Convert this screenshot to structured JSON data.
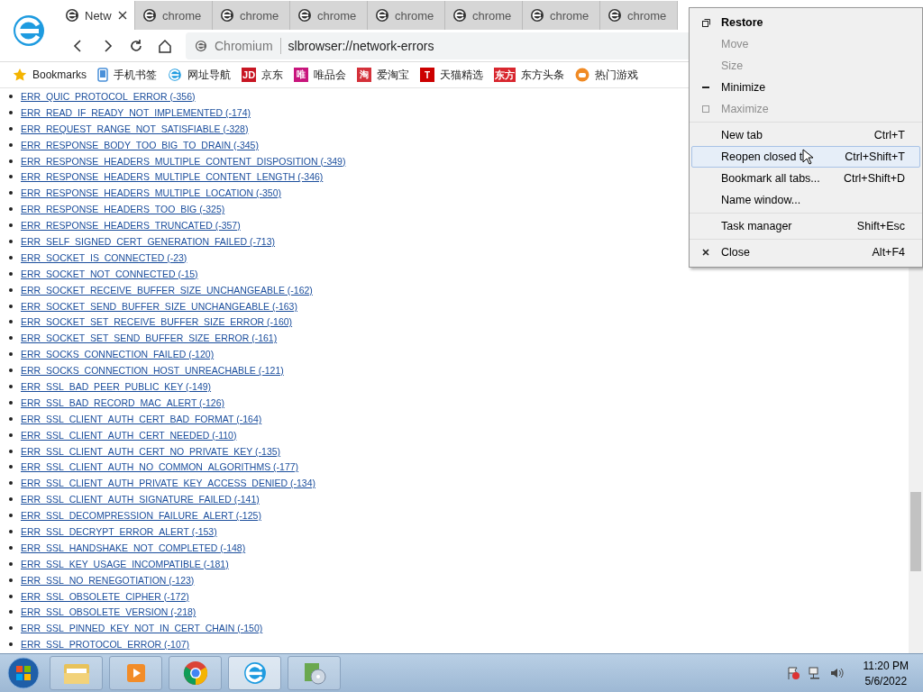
{
  "tabs": [
    {
      "title": "Netw",
      "selected": true,
      "closable": true
    },
    {
      "title": "chrome",
      "selected": false,
      "closable": false
    },
    {
      "title": "chrome",
      "selected": false,
      "closable": false
    },
    {
      "title": "chrome",
      "selected": false,
      "closable": false
    },
    {
      "title": "chrome",
      "selected": false,
      "closable": false
    },
    {
      "title": "chrome",
      "selected": false,
      "closable": false
    },
    {
      "title": "chrome",
      "selected": false,
      "closable": false
    },
    {
      "title": "chrome",
      "selected": false,
      "closable": false
    }
  ],
  "address_bar": {
    "site": "Chromium",
    "url": "slbrowser://network-errors"
  },
  "bookmarks": [
    {
      "label": "Bookmarks",
      "kind": "star"
    },
    {
      "label": "手机书签",
      "kind": "phone"
    },
    {
      "label": "网址导航",
      "kind": "browser"
    },
    {
      "label": "京东",
      "kind": "badge",
      "badge": "JD",
      "color": "#c81623"
    },
    {
      "label": "唯品会",
      "kind": "badge",
      "badge": "唯",
      "color": "#c8157c"
    },
    {
      "label": "爱淘宝",
      "kind": "badge",
      "badge": "淘",
      "color": "#d4313a"
    },
    {
      "label": "天猫精选",
      "kind": "badge",
      "badge": "T",
      "color": "#cc0000"
    },
    {
      "label": "东方头条",
      "kind": "badge",
      "badge": "东方",
      "color": "#d8262e"
    },
    {
      "label": "热门游戏",
      "kind": "game"
    }
  ],
  "error_links": [
    "ERR_QUIC_PROTOCOL_ERROR (-356)",
    "ERR_READ_IF_READY_NOT_IMPLEMENTED (-174)",
    "ERR_REQUEST_RANGE_NOT_SATISFIABLE (-328)",
    "ERR_RESPONSE_BODY_TOO_BIG_TO_DRAIN (-345)",
    "ERR_RESPONSE_HEADERS_MULTIPLE_CONTENT_DISPOSITION (-349)",
    "ERR_RESPONSE_HEADERS_MULTIPLE_CONTENT_LENGTH (-346)",
    "ERR_RESPONSE_HEADERS_MULTIPLE_LOCATION (-350)",
    "ERR_RESPONSE_HEADERS_TOO_BIG (-325)",
    "ERR_RESPONSE_HEADERS_TRUNCATED (-357)",
    "ERR_SELF_SIGNED_CERT_GENERATION_FAILED (-713)",
    "ERR_SOCKET_IS_CONNECTED (-23)",
    "ERR_SOCKET_NOT_CONNECTED (-15)",
    "ERR_SOCKET_RECEIVE_BUFFER_SIZE_UNCHANGEABLE (-162)",
    "ERR_SOCKET_SEND_BUFFER_SIZE_UNCHANGEABLE (-163)",
    "ERR_SOCKET_SET_RECEIVE_BUFFER_SIZE_ERROR (-160)",
    "ERR_SOCKET_SET_SEND_BUFFER_SIZE_ERROR (-161)",
    "ERR_SOCKS_CONNECTION_FAILED (-120)",
    "ERR_SOCKS_CONNECTION_HOST_UNREACHABLE (-121)",
    "ERR_SSL_BAD_PEER_PUBLIC_KEY (-149)",
    "ERR_SSL_BAD_RECORD_MAC_ALERT (-126)",
    "ERR_SSL_CLIENT_AUTH_CERT_BAD_FORMAT (-164)",
    "ERR_SSL_CLIENT_AUTH_CERT_NEEDED (-110)",
    "ERR_SSL_CLIENT_AUTH_CERT_NO_PRIVATE_KEY (-135)",
    "ERR_SSL_CLIENT_AUTH_NO_COMMON_ALGORITHMS (-177)",
    "ERR_SSL_CLIENT_AUTH_PRIVATE_KEY_ACCESS_DENIED (-134)",
    "ERR_SSL_CLIENT_AUTH_SIGNATURE_FAILED (-141)",
    "ERR_SSL_DECOMPRESSION_FAILURE_ALERT (-125)",
    "ERR_SSL_DECRYPT_ERROR_ALERT (-153)",
    "ERR_SSL_HANDSHAKE_NOT_COMPLETED (-148)",
    "ERR_SSL_KEY_USAGE_INCOMPATIBLE (-181)",
    "ERR_SSL_NO_RENEGOTIATION (-123)",
    "ERR_SSL_OBSOLETE_CIPHER (-172)",
    "ERR_SSL_OBSOLETE_VERSION (-218)",
    "ERR_SSL_PINNED_KEY_NOT_IN_CERT_CHAIN (-150)",
    "ERR_SSL_PROTOCOL_ERROR (-107)"
  ],
  "context_menu": {
    "groups": [
      [
        {
          "label": "Restore",
          "kind": "restore",
          "bold": true,
          "disabled": false,
          "selected": false
        },
        {
          "label": "Move",
          "kind": "plain",
          "bold": false,
          "disabled": true,
          "selected": false
        },
        {
          "label": "Size",
          "kind": "plain",
          "bold": false,
          "disabled": true,
          "selected": false
        },
        {
          "label": "Minimize",
          "kind": "minimize",
          "bold": false,
          "disabled": false,
          "selected": false
        },
        {
          "label": "Maximize",
          "kind": "maximize",
          "bold": false,
          "disabled": true,
          "selected": false
        }
      ],
      [
        {
          "label": "New tab",
          "shortcut": "Ctrl+T",
          "kind": "plain",
          "bold": false,
          "disabled": false,
          "selected": false
        },
        {
          "label": "Reopen closed t",
          "shortcut": "Ctrl+Shift+T",
          "kind": "plain",
          "bold": false,
          "disabled": false,
          "selected": true
        },
        {
          "label": "Bookmark all tabs...",
          "shortcut": "Ctrl+Shift+D",
          "kind": "plain",
          "bold": false,
          "disabled": false,
          "selected": false
        },
        {
          "label": "Name window...",
          "kind": "plain",
          "bold": false,
          "disabled": false,
          "selected": false
        }
      ],
      [
        {
          "label": "Task manager",
          "shortcut": "Shift+Esc",
          "kind": "plain",
          "bold": false,
          "disabled": false,
          "selected": false
        }
      ],
      [
        {
          "label": "Close",
          "shortcut": "Alt+F4",
          "kind": "close",
          "bold": false,
          "disabled": false,
          "selected": false
        }
      ]
    ]
  },
  "taskbar": {
    "apps": [
      {
        "kind": "folder",
        "selected": false
      },
      {
        "kind": "media",
        "selected": false
      },
      {
        "kind": "chrome",
        "selected": false
      },
      {
        "kind": "browser",
        "selected": true
      },
      {
        "kind": "installer",
        "selected": false
      }
    ],
    "clock": {
      "time": "11:20 PM",
      "date": "5/6/2022"
    }
  }
}
